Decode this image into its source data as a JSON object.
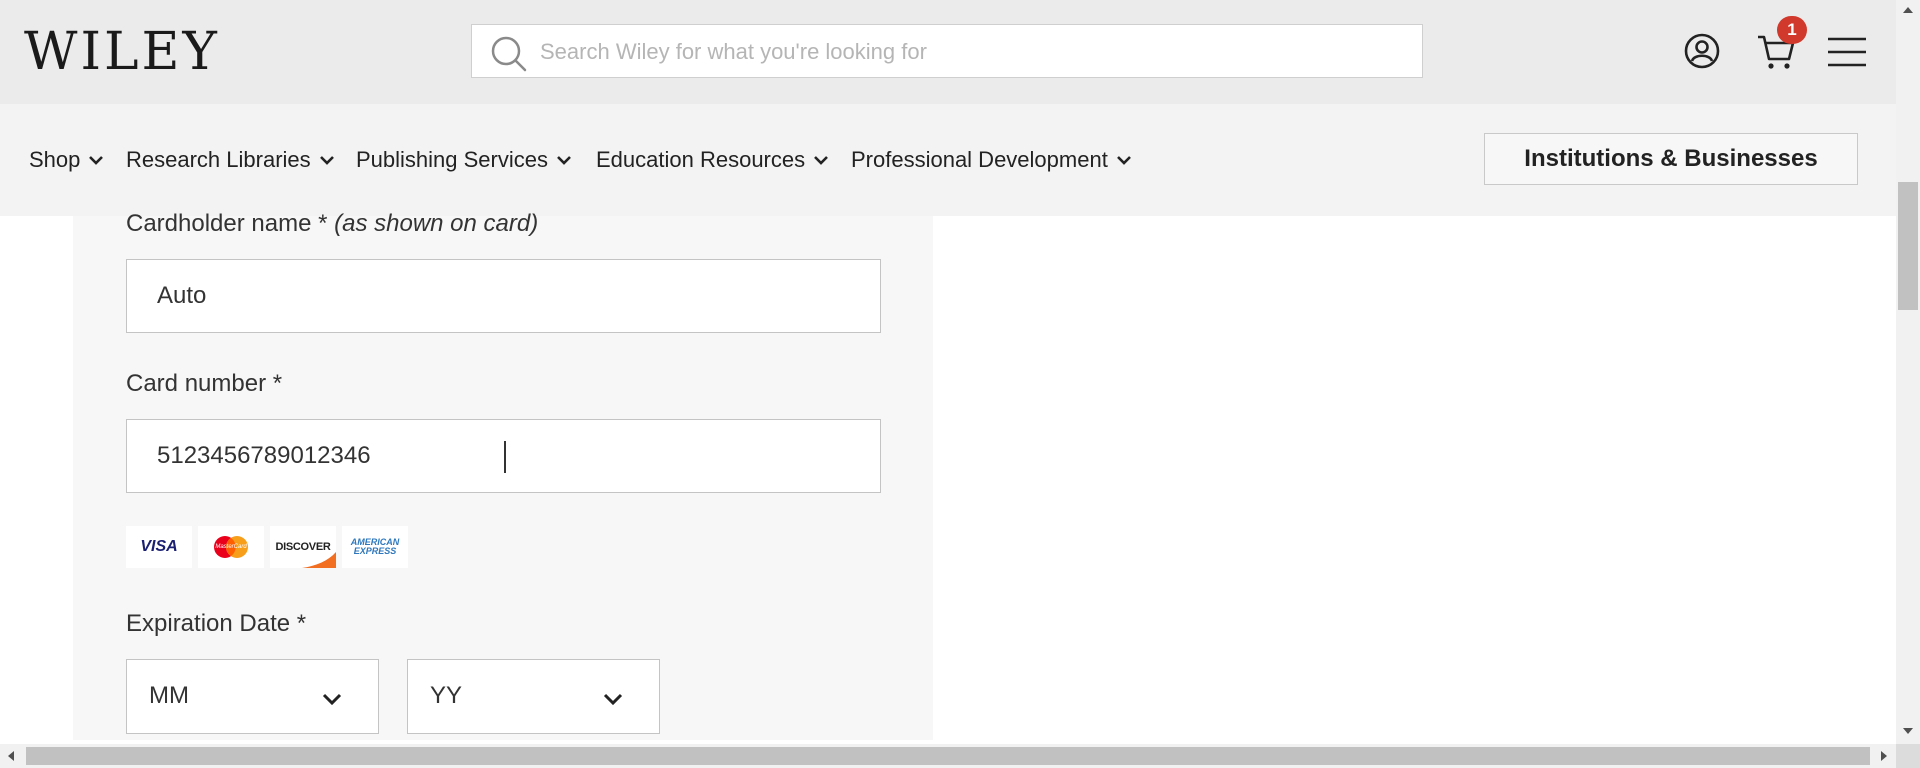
{
  "header": {
    "logo_text": "WILEY",
    "search": {
      "placeholder": "Search Wiley for what you're looking for",
      "value": ""
    },
    "cart_count": "1"
  },
  "nav": {
    "items": [
      {
        "label": "Shop"
      },
      {
        "label": "Research Libraries"
      },
      {
        "label": "Publishing Services"
      },
      {
        "label": "Education Resources"
      },
      {
        "label": "Professional Development"
      }
    ],
    "institutions_button": "Institutions & Businesses"
  },
  "form": {
    "cardholder": {
      "label": "Cardholder name *",
      "label_note": "(as shown on card)",
      "value": "Auto"
    },
    "card_number": {
      "label": "Card number *",
      "value": "5123456789012346"
    },
    "card_logos": [
      "VISA",
      "MasterCard",
      "DISCOVER",
      "AMERICAN EXPRESS"
    ],
    "expiration": {
      "label": "Expiration Date *",
      "month": "MM",
      "year": "YY"
    }
  },
  "colors": {
    "header_bg": "#ebebeb",
    "nav_bg": "#f3f3f3",
    "panel_bg": "#f7f7f7",
    "badge": "#d0392b"
  }
}
